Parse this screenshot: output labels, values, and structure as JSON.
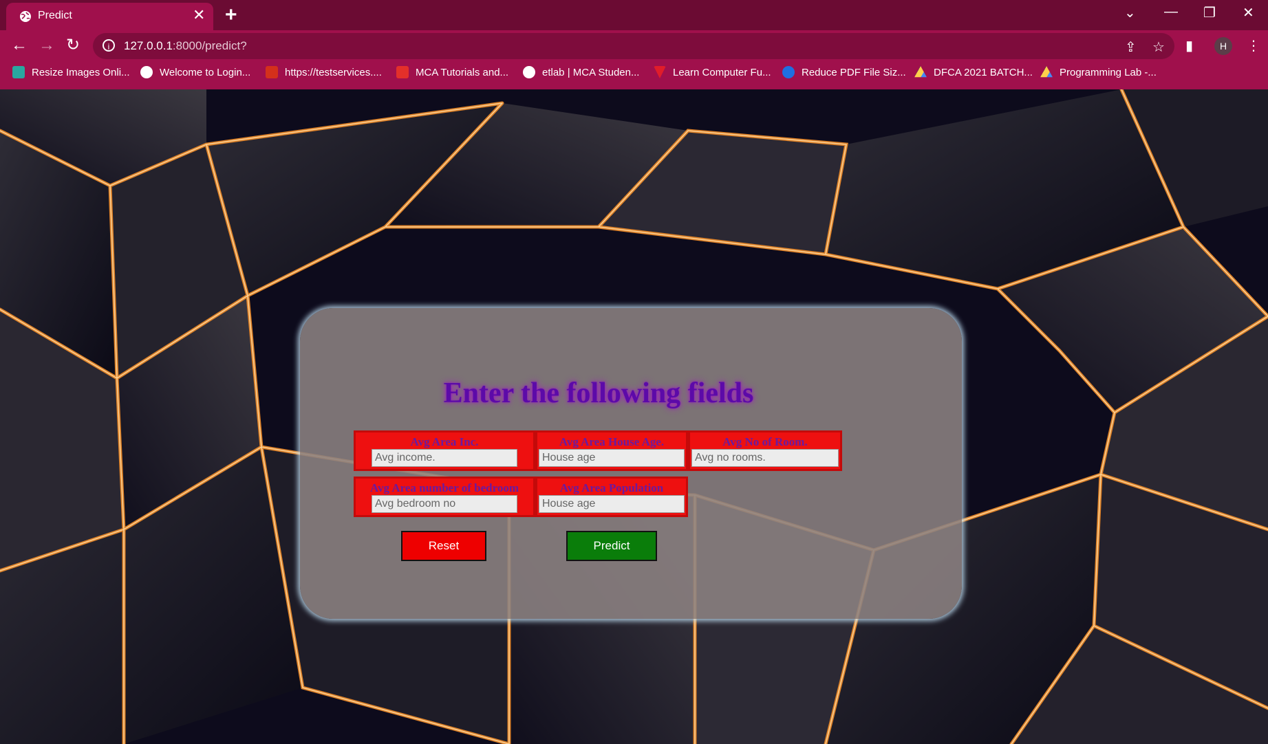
{
  "browser": {
    "tab_title": "Predict",
    "url_host": "127.0.0.1",
    "url_rest": ":8000/predict?",
    "profile_initial": "H",
    "bookmarks": [
      "Resize Images Onli...",
      "Welcome to Login...",
      "https://testservices....",
      "MCA Tutorials and...",
      "etlab | MCA Studen...",
      "Learn Computer Fu...",
      "Reduce PDF File Siz...",
      "DFCA 2021 BATCH...",
      "Programming Lab -..."
    ]
  },
  "form": {
    "heading": "Enter the following fields",
    "fields": [
      {
        "label": "Avg Area Inc.",
        "placeholder": "Avg income."
      },
      {
        "label": "Avg Area House Age.",
        "placeholder": "House age"
      },
      {
        "label": "Avg No of Room.",
        "placeholder": "Avg no rooms."
      },
      {
        "label": "Avg Area number of bedroom",
        "placeholder": "Avg bedroom no"
      },
      {
        "label": "Avg Area Population",
        "placeholder": "House age"
      }
    ],
    "reset_label": "Reset",
    "predict_label": "Predict"
  },
  "colors": {
    "chrome": "#a0104c",
    "field_bg": "#ee1010",
    "reset_bg": "#ee0000",
    "predict_bg": "#0a7d0a"
  }
}
